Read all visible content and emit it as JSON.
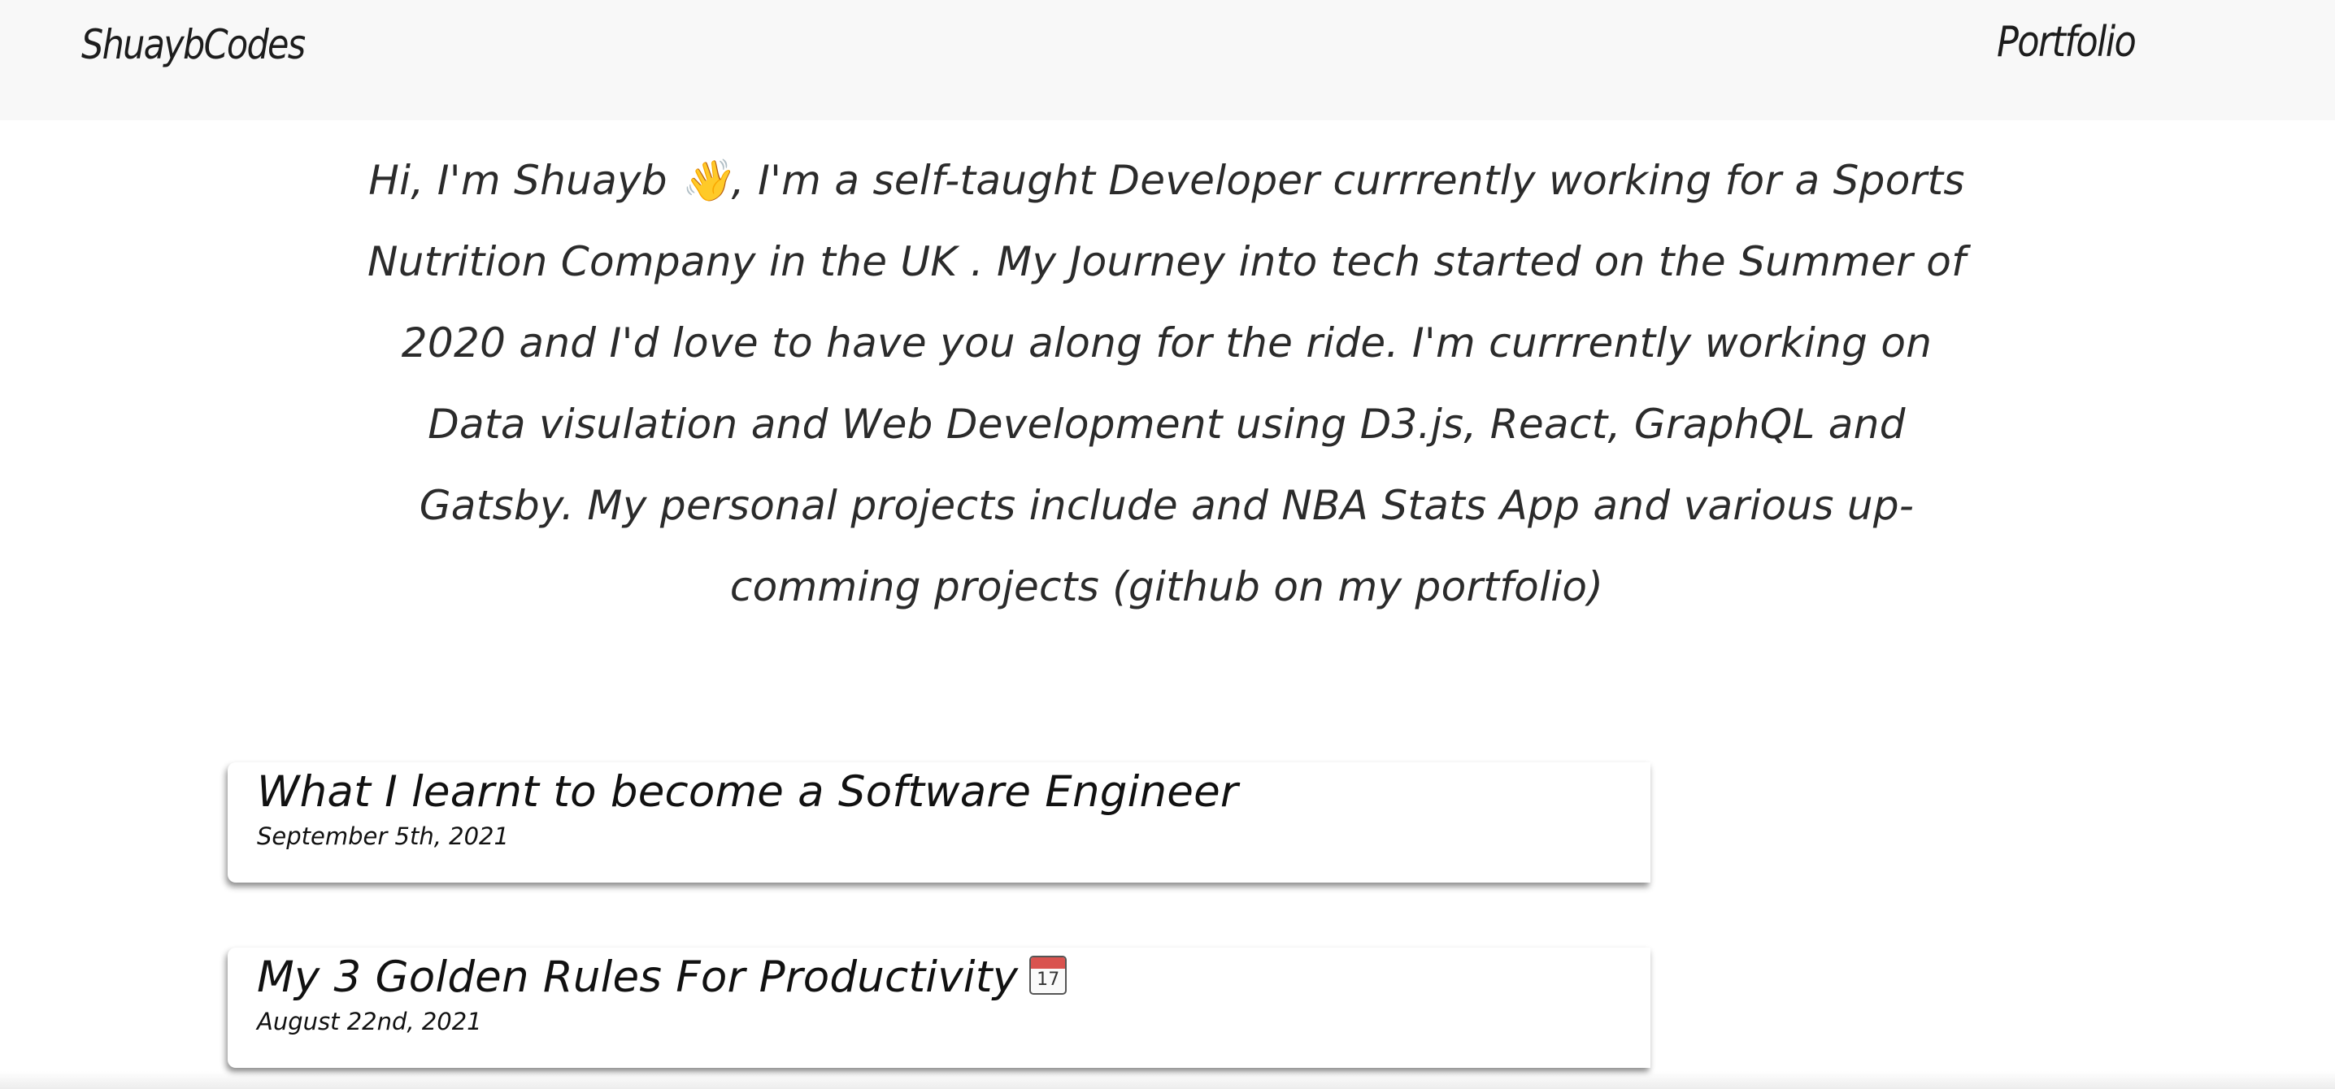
{
  "header": {
    "brand": "ShuaybCodes",
    "nav_link": "Portfolio"
  },
  "intro": {
    "text": "Hi, I'm Shuayb 👋, I'm a self-taught Developer currrently working for a Sports Nutrition Company in the UK . My Journey into tech started on the Summer of 2020 and I'd love to have you along for the ride. I'm currrently working on Data visulation and Web Development using D3.js, React, GraphQL and Gatsby. My personal projects include and NBA Stats App and various up-comming projects (github on my portfolio)"
  },
  "posts": [
    {
      "title": "What I learnt to become a Software Engineer",
      "date": "September 5th, 2021"
    },
    {
      "title": "My 3 Golden Rules For Productivity",
      "icon": "calendar-icon",
      "icon_text": "17",
      "date": "August 22nd, 2021"
    }
  ],
  "colors": {
    "header_background": "#f8f8f8",
    "text": "#222222",
    "card_background": "#ffffff"
  }
}
